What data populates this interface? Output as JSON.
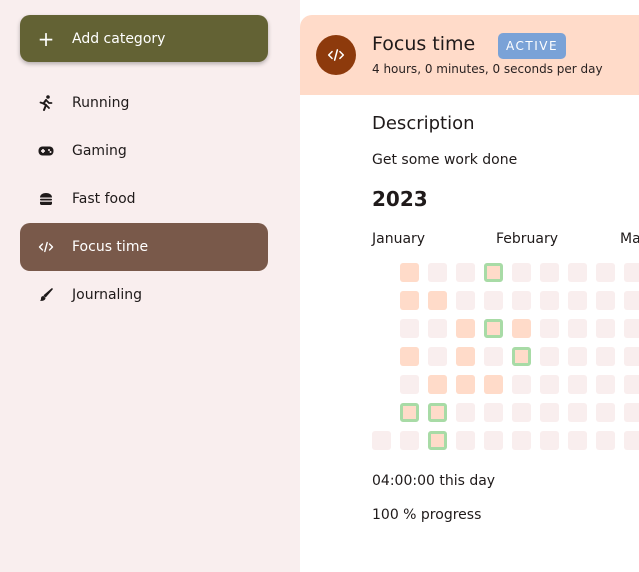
{
  "sidebar": {
    "add_button": "Add category",
    "items": [
      {
        "label": "Running",
        "icon": "running-icon",
        "selected": false
      },
      {
        "label": "Gaming",
        "icon": "gamepad-icon",
        "selected": false
      },
      {
        "label": "Fast food",
        "icon": "burger-icon",
        "selected": false
      },
      {
        "label": "Focus time",
        "icon": "code-icon",
        "selected": true
      },
      {
        "label": "Journaling",
        "icon": "brush-icon",
        "selected": false
      }
    ]
  },
  "header": {
    "icon": "code-icon",
    "title": "Focus time",
    "badge": "ACTIVE",
    "subtitle": "4 hours, 0 minutes, 0 seconds per day"
  },
  "details": {
    "section_title": "Description",
    "description": "Get some work done",
    "year": "2023",
    "months": [
      "January",
      "February",
      "Ma"
    ],
    "heatmap_legend": {
      "empty": 0,
      "some progress": 1,
      "goal reached": 2
    },
    "heatmap": [
      [
        -1,
        1,
        0,
        0,
        2,
        0,
        0,
        0,
        0,
        0
      ],
      [
        -1,
        1,
        1,
        0,
        0,
        0,
        0,
        0,
        0,
        0
      ],
      [
        -1,
        0,
        0,
        1,
        2,
        1,
        0,
        0,
        0,
        0
      ],
      [
        -1,
        1,
        0,
        1,
        0,
        2,
        0,
        0,
        0,
        0
      ],
      [
        -1,
        0,
        1,
        1,
        1,
        0,
        0,
        0,
        0,
        0
      ],
      [
        -1,
        2,
        2,
        0,
        0,
        0,
        0,
        0,
        0,
        0
      ],
      [
        0,
        0,
        2,
        0,
        0,
        0,
        0,
        0,
        0,
        0
      ]
    ],
    "time_today": "04:00:00 this day",
    "progress": "100 % progress"
  },
  "colors": {
    "add_button_bg": "#636234",
    "selected_item_bg": "#79594a",
    "header_bg": "#ffdbc9",
    "header_icon_bg": "#8d3a0c",
    "badge_bg": "#7aa2d7",
    "cell_empty": "#f9eeee",
    "cell_partial": "#ffdbc9",
    "cell_goal_border": "#a8dba6"
  }
}
